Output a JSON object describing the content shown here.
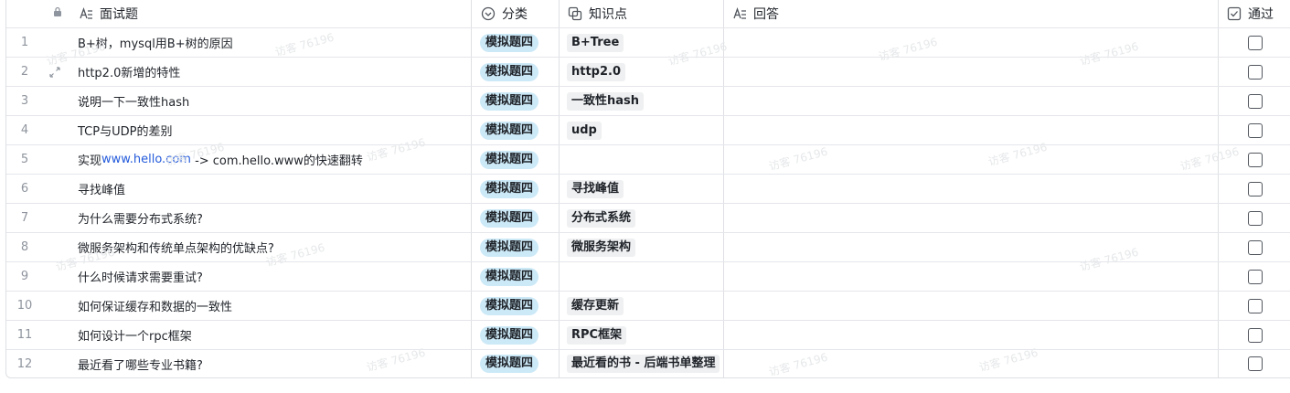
{
  "header": {
    "question_label": "面试题",
    "category_label": "分类",
    "knowledge_label": "知识点",
    "answer_label": "回答",
    "pass_label": "通过"
  },
  "watermark": "访客 76196",
  "colors": {
    "category_tag_bg": "#cce9f7",
    "knowledge_tag_bg": "#eff0f1",
    "link": "#245bdb",
    "border": "#dee0e3"
  },
  "rows": [
    {
      "index": "1",
      "question": "B+树，mysql用B+树的原因",
      "category": "模拟题四",
      "knowledge": "B+Tree",
      "passed": false
    },
    {
      "index": "2",
      "question": "http2.0新增的特性",
      "category": "模拟题四",
      "knowledge": "http2.0",
      "passed": false
    },
    {
      "index": "3",
      "question": "说明一下一致性hash",
      "category": "模拟题四",
      "knowledge": "一致性hash",
      "passed": false
    },
    {
      "index": "4",
      "question": "TCP与UDP的差别",
      "category": "模拟题四",
      "knowledge": "udp",
      "passed": false
    },
    {
      "index": "5",
      "question_prefix": "实现",
      "question_link": "www.hello.com",
      "question_suffix": " -> com.hello.www的快速翻转",
      "category": "模拟题四",
      "knowledge": "",
      "passed": false
    },
    {
      "index": "6",
      "question": "寻找峰值",
      "category": "模拟题四",
      "knowledge": "寻找峰值",
      "passed": false
    },
    {
      "index": "7",
      "question": "为什么需要分布式系统?",
      "category": "模拟题四",
      "knowledge": "分布式系统",
      "passed": false
    },
    {
      "index": "8",
      "question": "微服务架构和传统单点架构的优缺点?",
      "category": "模拟题四",
      "knowledge": "微服务架构",
      "passed": false
    },
    {
      "index": "9",
      "question": "什么时候请求需要重试?",
      "category": "模拟题四",
      "knowledge": "",
      "passed": false
    },
    {
      "index": "10",
      "question": "如何保证缓存和数据的一致性",
      "category": "模拟题四",
      "knowledge": "缓存更新",
      "passed": false
    },
    {
      "index": "11",
      "question": "如何设计一个rpc框架",
      "category": "模拟题四",
      "knowledge": "RPC框架",
      "passed": false
    },
    {
      "index": "12",
      "question": "最近看了哪些专业书籍?",
      "category": "模拟题四",
      "knowledge": "最近看的书 - 后端书单整理",
      "passed": false
    }
  ]
}
